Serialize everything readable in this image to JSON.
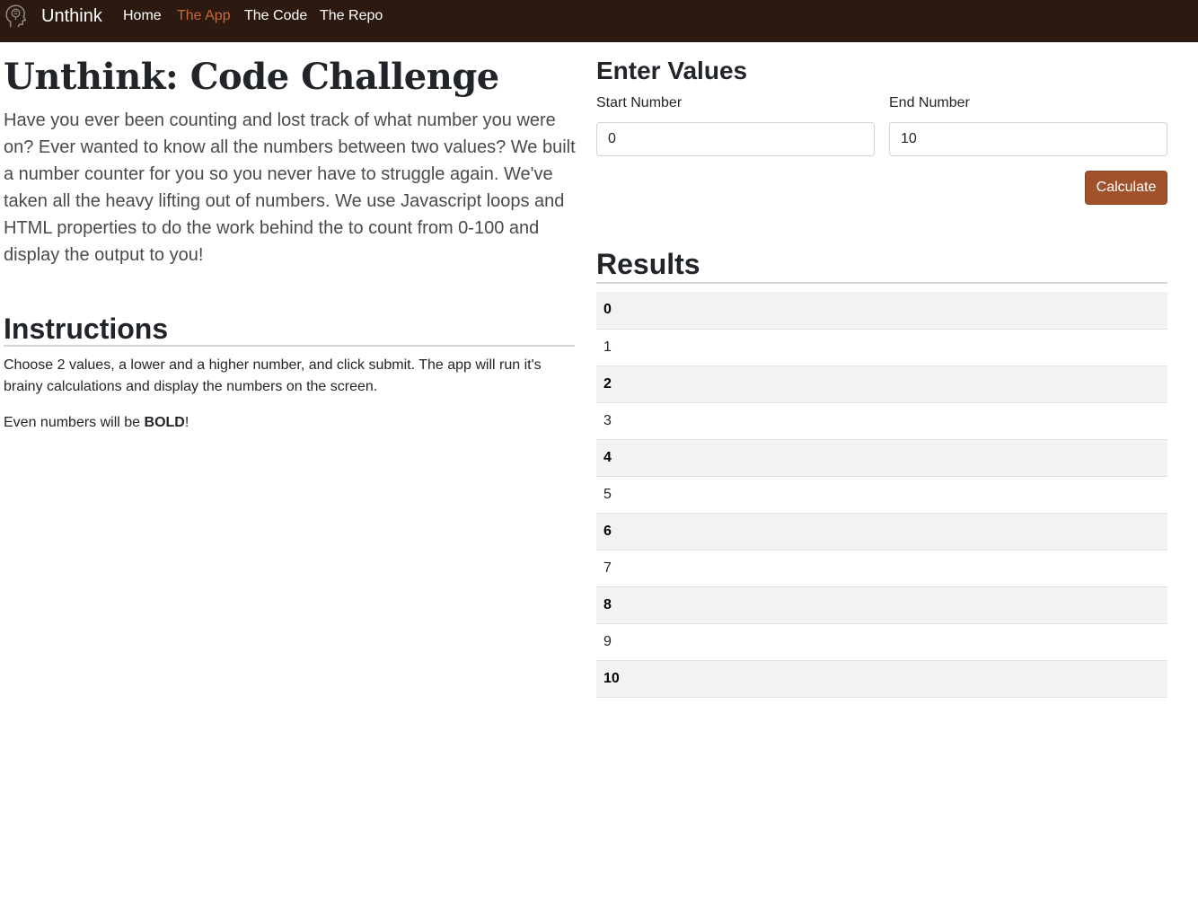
{
  "navbar": {
    "brand": "Unthink",
    "links": [
      {
        "label": "Home",
        "active": false
      },
      {
        "label": "The App",
        "active": true
      },
      {
        "label": "The Code",
        "active": false
      },
      {
        "label": "The Repo",
        "active": false
      }
    ]
  },
  "intro": {
    "title": "Unthink: Code Challenge",
    "text": "Have you ever been counting and lost track of what number you were on? Ever wanted to know all the numbers between two values? We built a number counter for you so you never have to struggle again. We've taken all the heavy lifting out of numbers. We use Javascript loops and HTML properties to do the work behind the to count from 0-100 and display the output to you!"
  },
  "instructions": {
    "heading": "Instructions",
    "text": "Choose 2 values, a lower and a higher number, and click submit. The app will run it's brainy calculations and display the numbers on the screen.",
    "even_prefix": "Even numbers will be ",
    "even_bold": "BOLD",
    "even_suffix": "!"
  },
  "form": {
    "heading": "Enter Values",
    "start_label": "Start Number",
    "start_value": "0",
    "end_label": "End Number",
    "end_value": "10",
    "button": "Calculate"
  },
  "results": {
    "heading": "Results",
    "rows": [
      "0",
      "1",
      "2",
      "3",
      "4",
      "5",
      "6",
      "7",
      "8",
      "9",
      "10"
    ]
  },
  "colors": {
    "navbar_bg": "#2c1a10",
    "active_link": "#c9693e",
    "button_bg": "#a0522d",
    "even_row_bg": "#f2f2f2"
  },
  "icons": {
    "brand_logo": "head-brain-icon"
  }
}
